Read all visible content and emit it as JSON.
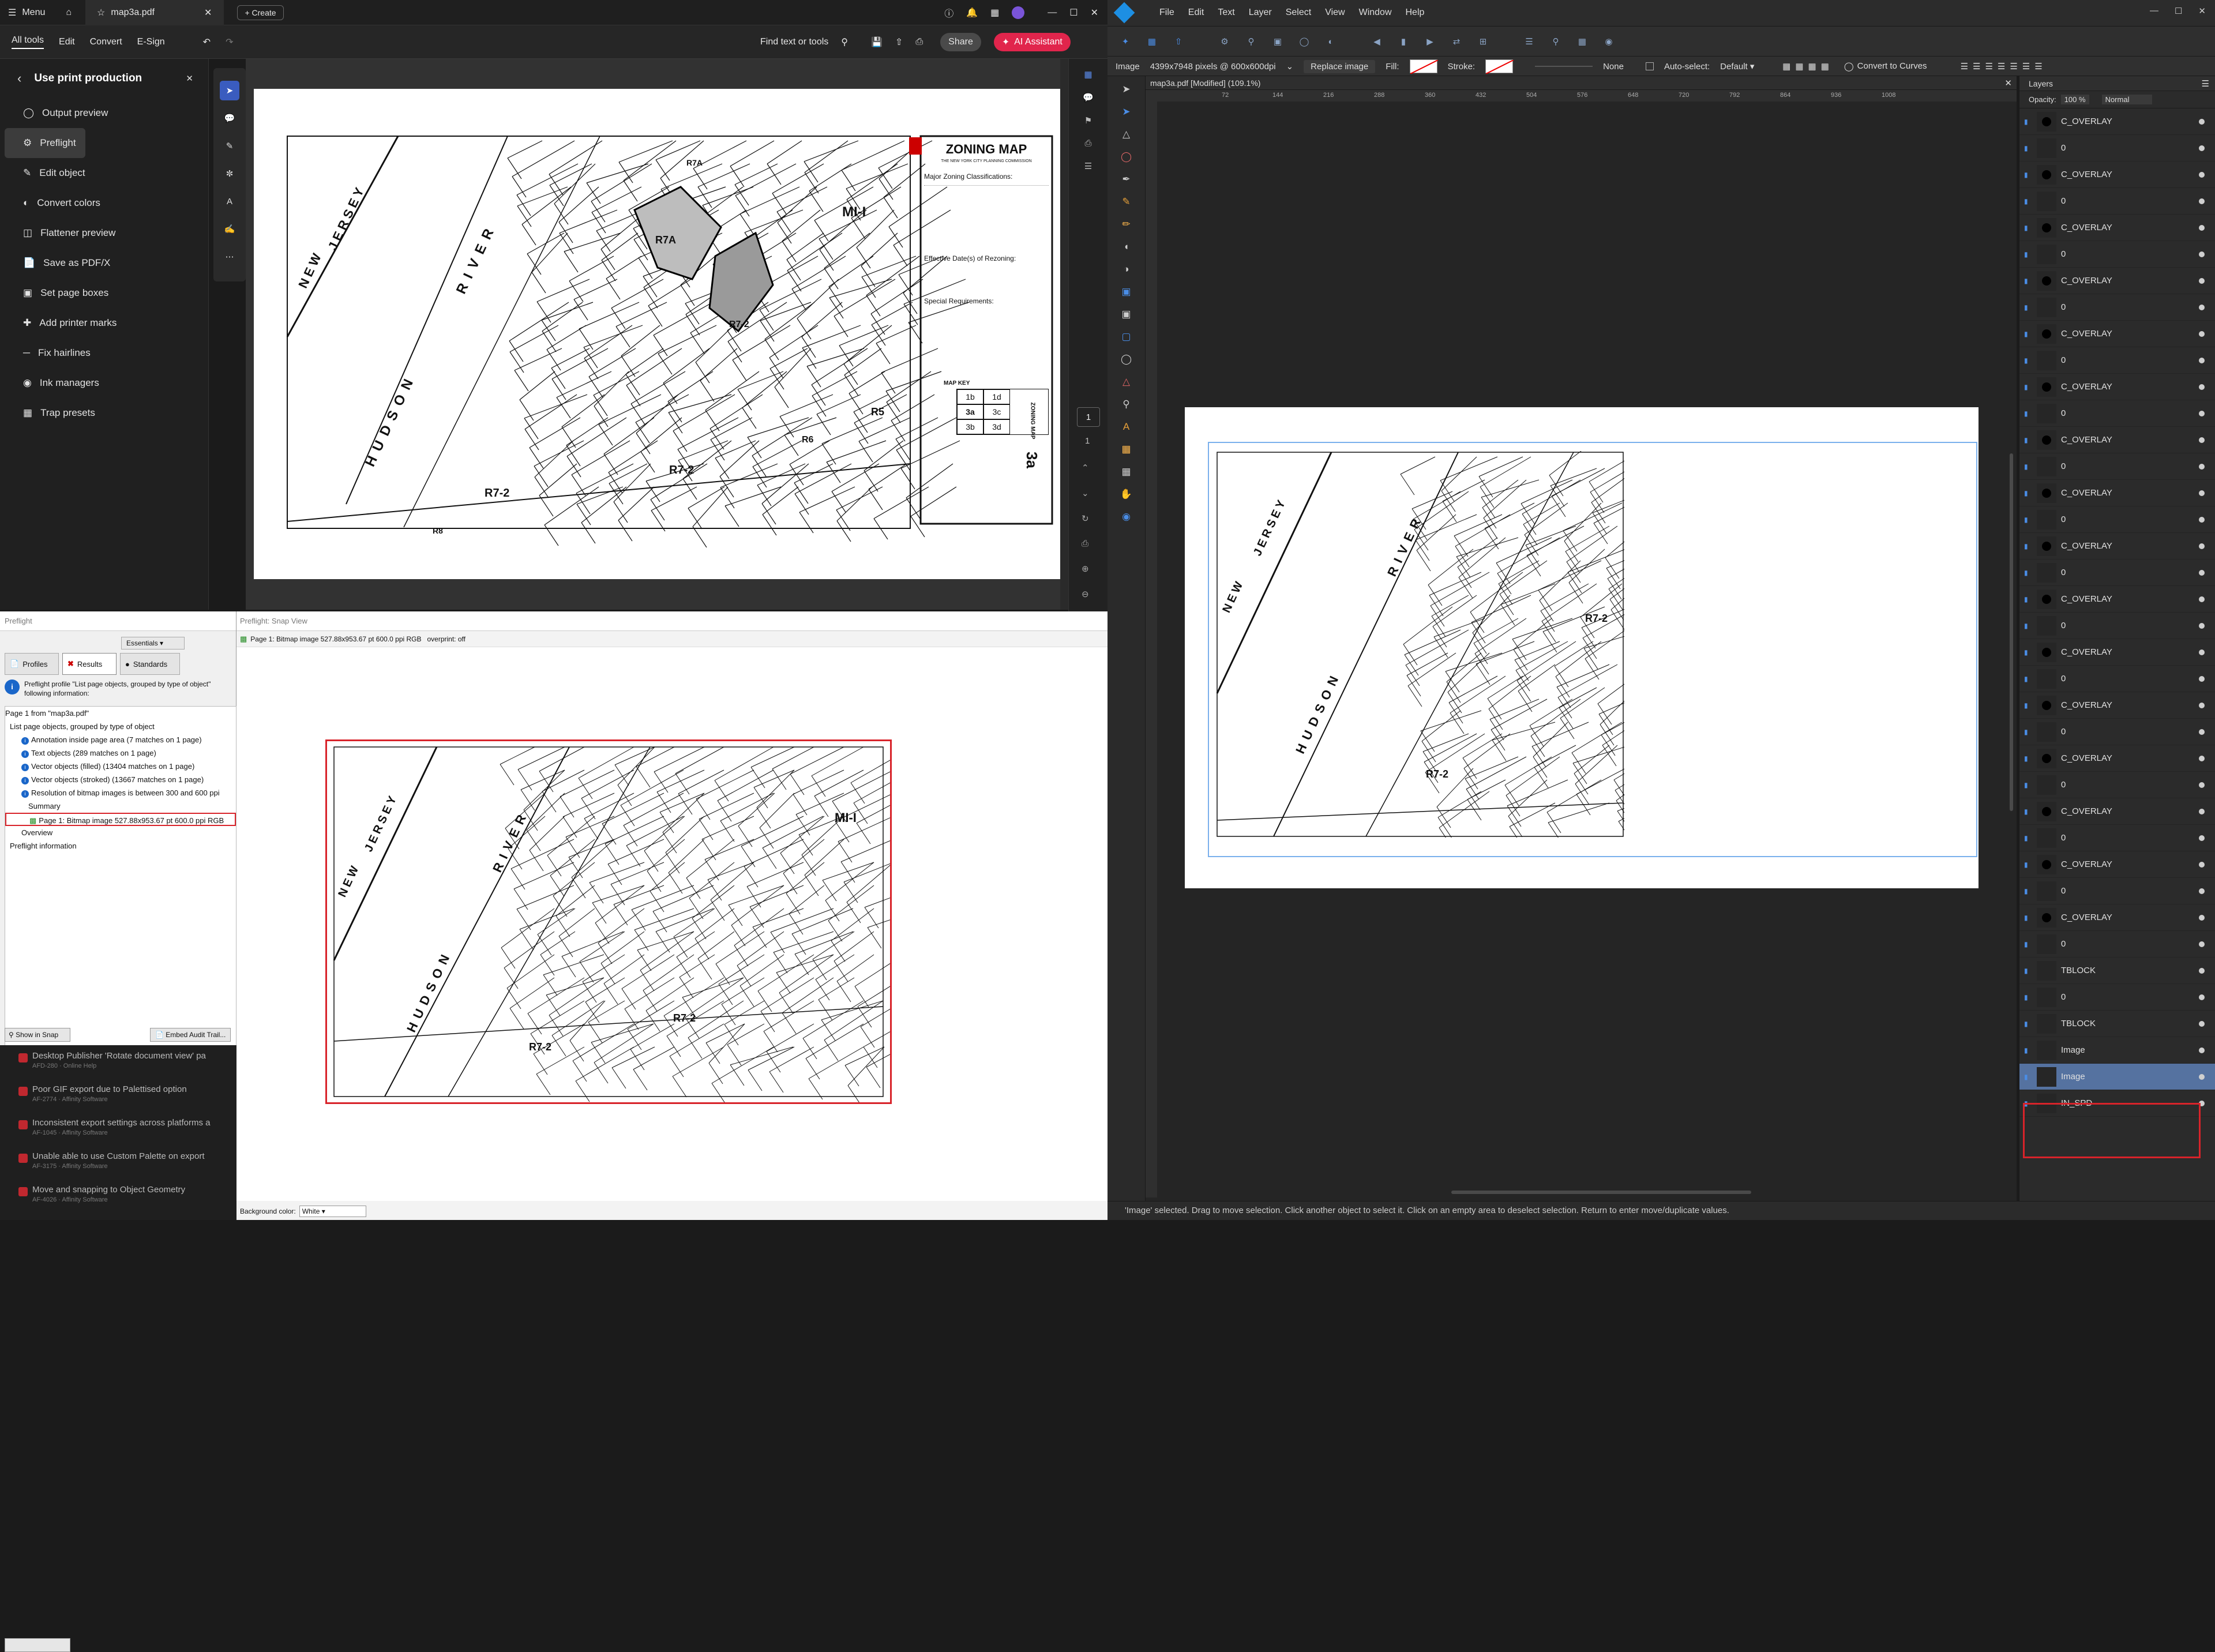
{
  "acrobat": {
    "menu": "Menu",
    "tab_name": "map3a.pdf",
    "create": "Create",
    "toolbar_tabs": [
      "All tools",
      "Edit",
      "Convert",
      "E-Sign"
    ],
    "find": "Find text or tools",
    "share": "Share",
    "ai": "AI Assistant",
    "panel_title": "Use print production",
    "panel_items": [
      "Output preview",
      "Preflight",
      "Edit object",
      "Convert colors",
      "Flattener preview",
      "Save as PDF/X",
      "Set page boxes",
      "Add printer marks",
      "Fix hairlines",
      "Ink managers",
      "Trap presets"
    ],
    "page_num": "1",
    "page_total": "1"
  },
  "map": {
    "title": "ZONING MAP",
    "subtitle": "THE NEW YORK CITY PLANNING COMMISSION",
    "major": "Major Zoning Classifications:",
    "effective": "Effective Date(s) of Rezoning:",
    "special": "Special Requirements:",
    "map_key": "MAP KEY",
    "keys": [
      "1b",
      "1d",
      "3a",
      "3c",
      "3b",
      "3d"
    ],
    "big": "3a",
    "side": "ZONING MAP",
    "labels": [
      "NEW",
      "JERSEY",
      "RIVER",
      "HUDSON",
      "R7-2",
      "R7-2",
      "R7A",
      "R7A",
      "MI-I",
      "R8",
      "R6",
      "R5",
      "R7-2"
    ],
    "labels_snap": [
      "NEW",
      "JERSEY",
      "RIVER",
      "HUDSON",
      "R7-2",
      "R7-2",
      "MI-I"
    ],
    "labels_aff": [
      "NEW",
      "JERSEY",
      "RIVER",
      "HUDSON",
      "R7-2",
      "R7-2"
    ]
  },
  "preflight": {
    "title": "Preflight",
    "essentials": "Essentials",
    "tabs": [
      "Profiles",
      "Results",
      "Standards"
    ],
    "info": "Preflight profile \"List page objects, grouped by type of object\" following information:",
    "tree": [
      "Page 1 from \"map3a.pdf\"",
      "List page objects, grouped by type of object",
      "Annotation inside page area (7 matches on 1 page)",
      "Text objects (289 matches on 1 page)",
      "Vector objects (filled) (13404 matches on 1 page)",
      "Vector objects (stroked) (13667 matches on 1 page)",
      "Resolution of bitmap images is between 300 and 600 ppi",
      "Summary",
      "Page 1: Bitmap image 527.88x953.67 pt 600.0 ppi RGB",
      "Overview",
      "Preflight information"
    ],
    "show_in_snap": "Show in Snap",
    "embed": "Embed Audit Trail...",
    "forum": [
      {
        "t": "Desktop Publisher 'Rotate document view' pa",
        "s": "AFD-280 · Online Help"
      },
      {
        "t": "Poor GIF export due to Palettised option",
        "s": "AF-2774 · Affinity Software"
      },
      {
        "t": "Inconsistent export settings across platforms a",
        "s": "AF-1045 · Affinity Software"
      },
      {
        "t": "Unable able to use Custom Palette on export",
        "s": "AF-3175 · Affinity Software"
      },
      {
        "t": "Move and snapping to Object Geometry",
        "s": "AF-4026 · Affinity Software"
      }
    ]
  },
  "snap": {
    "title": "Preflight: Snap View",
    "header": "Page 1: Bitmap image 527.88x953.67 pt 600.0 ppi RGB   overprint: off",
    "bg_label": "Background color:",
    "bg_value": "White"
  },
  "affinity": {
    "menus": [
      "File",
      "Edit",
      "Text",
      "Layer",
      "Select",
      "View",
      "Window",
      "Help"
    ],
    "ctx_type": "Image",
    "ctx_dims": "4399x7948 pixels @ 600x600dpi",
    "replace": "Replace image",
    "fill": "Fill:",
    "stroke": "Stroke:",
    "none": "None",
    "autoselect": "Auto-select:",
    "default": "Default",
    "convert": "Convert to Curves",
    "doc_tab": "map3a.pdf [Modified] (109.1%)",
    "ruler": [
      "72",
      "144",
      "216",
      "288",
      "360",
      "432",
      "504",
      "576",
      "648",
      "720",
      "792",
      "864",
      "936",
      "1008"
    ],
    "layers_title": "Layers",
    "opacity_label": "Opacity:",
    "opacity": "100 %",
    "blend": "Normal",
    "layer_rows": [
      "C_OVERLAY",
      "0",
      "C_OVERLAY",
      "0",
      "C_OVERLAY",
      "0",
      "C_OVERLAY",
      "0",
      "C_OVERLAY",
      "0",
      "C_OVERLAY",
      "0",
      "C_OVERLAY",
      "0",
      "C_OVERLAY",
      "0",
      "C_OVERLAY",
      "0",
      "C_OVERLAY",
      "0",
      "C_OVERLAY",
      "0",
      "C_OVERLAY",
      "0",
      "C_OVERLAY",
      "0",
      "C_OVERLAY",
      "0",
      "C_OVERLAY",
      "0",
      "C_OVERLAY",
      "0",
      "TBLOCK",
      "0",
      "TBLOCK",
      "Image",
      "Image",
      "IN_SPD"
    ],
    "status_pre": "'Image' selected.",
    "status": " Drag to move selection. Click another object to select it. Click on an empty area to deselect selection. Return to enter move/duplicate values."
  },
  "colors": {
    "accent": "#e1254c",
    "affinity_blue": "#4a8de6",
    "highlight": "#d8232a"
  }
}
